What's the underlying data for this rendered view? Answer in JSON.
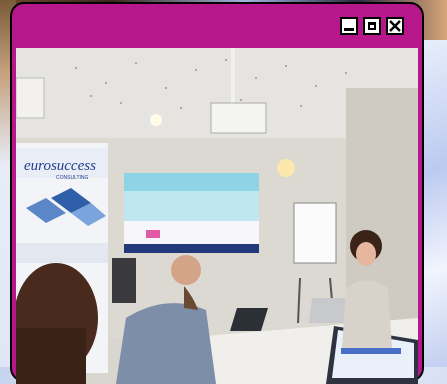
{
  "window": {
    "controls": {
      "minimize": "minimize-icon",
      "maximize": "maximize-icon",
      "close": "close-icon"
    },
    "accent_color": "#b6178a"
  },
  "photo": {
    "banner_text": "eurosuccess",
    "banner_subtext": "CONSULTING"
  }
}
